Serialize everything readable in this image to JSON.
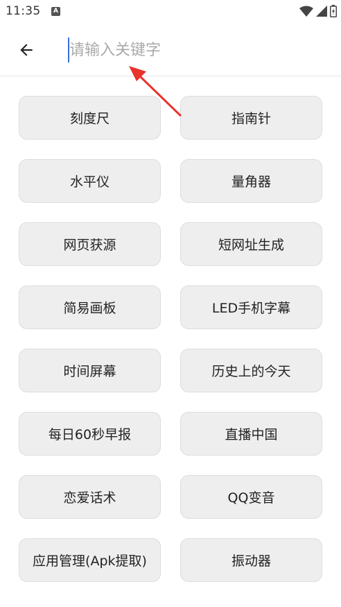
{
  "status_bar": {
    "time": "11:35",
    "notification_icon": "a-icon",
    "icons": [
      "wifi-icon",
      "signal-icon",
      "battery-icon"
    ]
  },
  "header": {
    "back_icon": "arrow-left-icon",
    "search_placeholder": "请输入关键字",
    "search_value": ""
  },
  "tools": [
    {
      "label": "刻度尺"
    },
    {
      "label": "指南针"
    },
    {
      "label": "水平仪"
    },
    {
      "label": "量角器"
    },
    {
      "label": "网页获源"
    },
    {
      "label": "短网址生成"
    },
    {
      "label": "简易画板"
    },
    {
      "label": "LED手机字幕"
    },
    {
      "label": "时间屏幕"
    },
    {
      "label": "历史上的今天"
    },
    {
      "label": "每日60秒早报"
    },
    {
      "label": "直播中国"
    },
    {
      "label": "恋爱话术"
    },
    {
      "label": "QQ变音"
    },
    {
      "label": "应用管理(Apk提取)"
    },
    {
      "label": "振动器"
    }
  ],
  "colors": {
    "annotation_arrow": "#e8322b",
    "button_bg": "#eeeeee",
    "cursor": "#3b6fd8"
  }
}
